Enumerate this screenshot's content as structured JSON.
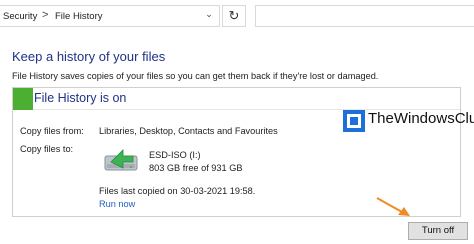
{
  "address_bar": {
    "crumbs": [
      "Security",
      "File History"
    ],
    "separator": ">",
    "dropdown_glyph": "⌄",
    "refresh_glyph": "↻",
    "search_value": ""
  },
  "content": {
    "title": "Keep a history of your files",
    "description": "File History saves copies of your files so you can get them back if they're lost or damaged."
  },
  "panel": {
    "status": "File History is on",
    "status_color": "#4caf31",
    "copy_from_label": "Copy files from:",
    "copy_from_value": "Libraries, Desktop, Contacts and Favourites",
    "copy_to_label": "Copy files to:",
    "drive_name": "ESD-ISO (I:)",
    "drive_free": "803 GB free of 931 GB",
    "last_copied": "Files last copied on 30-03-2021 19:58.",
    "run_now": "Run now"
  },
  "watermark": {
    "text": "TheWindowsClub"
  },
  "actions": {
    "turn_off": "Turn off"
  },
  "colors": {
    "title_blue": "#1e3287",
    "link_blue": "#1f5ec9",
    "arrow_orange": "#f08a24"
  },
  "icons": [
    "chevron-right-icon",
    "chevron-down-icon",
    "refresh-icon",
    "drive-icon",
    "windowsclub-logo-icon",
    "annotation-arrow-icon"
  ]
}
